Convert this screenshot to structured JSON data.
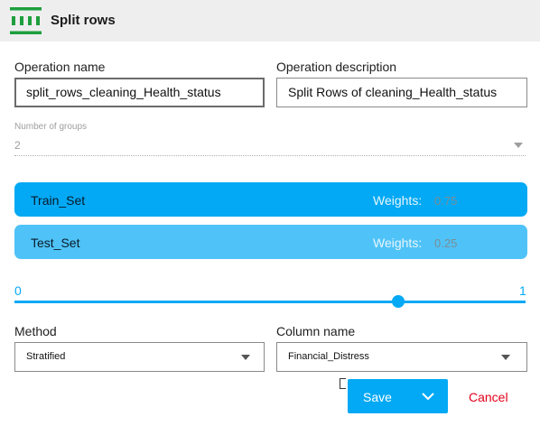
{
  "header": {
    "title": "Split rows",
    "icon": "split-rows-icon",
    "icon_color": "#1e9e3e"
  },
  "operation": {
    "name_label": "Operation name",
    "name_value": "split_rows_cleaning_Health_status",
    "description_label": "Operation description",
    "description_value": "Split Rows of cleaning_Health_status"
  },
  "number_of_groups": {
    "label": "Number of groups",
    "value": "2"
  },
  "groups": [
    {
      "name": "Train_Set",
      "weight_label": "Weights:",
      "weight_value": "0.75",
      "color": "#03a9f4"
    },
    {
      "name": "Test_Set",
      "weight_label": "Weights:",
      "weight_value": "0.25",
      "color": "#4fc3f7"
    }
  ],
  "slider": {
    "min_label": "0",
    "max_label": "1",
    "value": 0.75,
    "color": "#03a9f4"
  },
  "method": {
    "label": "Method",
    "value": "Stratified"
  },
  "column": {
    "label": "Column name",
    "value": "Financial_Distress"
  },
  "actions": {
    "save_label": "Save",
    "cancel_label": "Cancel",
    "save_color": "#03a9f4",
    "cancel_color": "#e3001b"
  }
}
